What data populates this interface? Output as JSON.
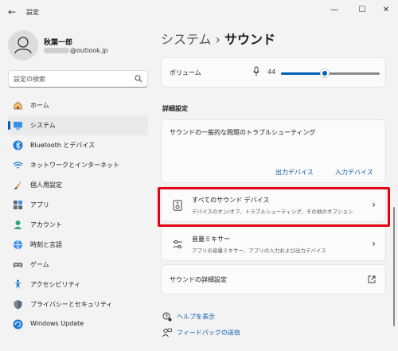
{
  "window": {
    "title": "設定",
    "minimize": "—",
    "maximize": "☐",
    "close": "✕",
    "back": "←"
  },
  "profile": {
    "name": "秋葉一郎",
    "email_suffix": "@outlook.jp"
  },
  "search": {
    "placeholder": "設定の検索"
  },
  "sidebar": {
    "items": [
      {
        "label": "ホーム",
        "icon": "home-icon"
      },
      {
        "label": "システム",
        "icon": "system-icon",
        "selected": true
      },
      {
        "label": "Bluetooth とデバイス",
        "icon": "bluetooth-icon"
      },
      {
        "label": "ネットワークとインターネット",
        "icon": "wifi-icon"
      },
      {
        "label": "個人用設定",
        "icon": "brush-icon"
      },
      {
        "label": "アプリ",
        "icon": "apps-icon"
      },
      {
        "label": "アカウント",
        "icon": "account-icon"
      },
      {
        "label": "時刻と言語",
        "icon": "globe-icon"
      },
      {
        "label": "ゲーム",
        "icon": "gamepad-icon"
      },
      {
        "label": "アクセシビリティ",
        "icon": "accessibility-icon"
      },
      {
        "label": "プライバシーとセキュリティ",
        "icon": "shield-icon"
      },
      {
        "label": "Windows Update",
        "icon": "update-icon"
      }
    ]
  },
  "header": {
    "crumb_parent": "システム",
    "separator": "›",
    "crumb_current": "サウンド"
  },
  "volume": {
    "label": "ボリューム",
    "value": "44",
    "level": 0.44
  },
  "advanced_section": {
    "title": "詳細設定"
  },
  "troubleshoot": {
    "label": "サウンドの一般的な問題のトラブルシューティング",
    "output_link": "出力デバイス",
    "input_link": "入力デバイス"
  },
  "all_devices": {
    "title": "すべてのサウンド デバイス",
    "subtitle": "デバイスのオン/オフ、トラブルシューティング、その他のオプション",
    "chevron": "›"
  },
  "mixer": {
    "title": "音量ミキサー",
    "subtitle": "アプリの音量ミキサー、アプリの入力および出力デバイス",
    "chevron": "›"
  },
  "more_settings": {
    "label": "サウンドの詳細設定"
  },
  "help": {
    "get_help": "ヘルプを表示",
    "feedback": "フィードバックの送信"
  },
  "colors": {
    "accent": "#005fb8",
    "highlight": "#e60012",
    "link": "#0a5aa8"
  }
}
